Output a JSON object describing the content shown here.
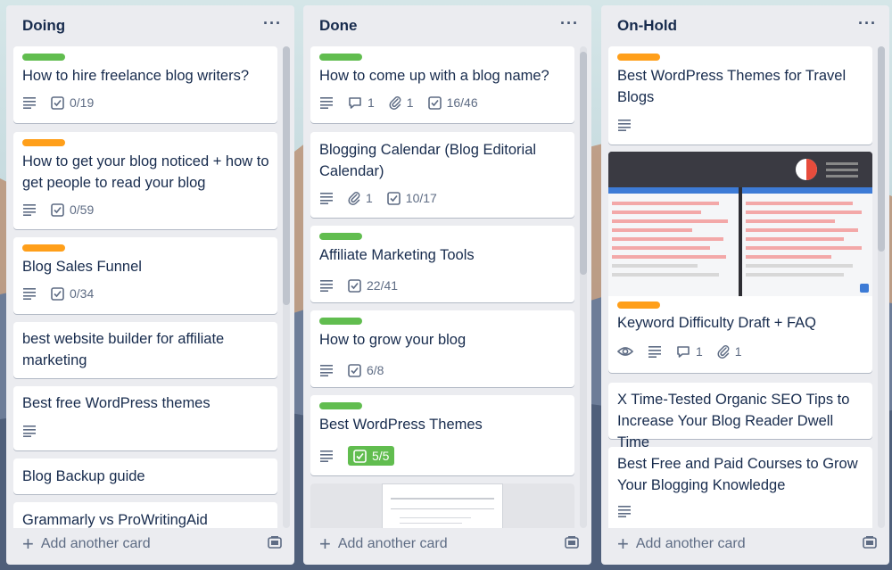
{
  "board": {
    "lists": [
      {
        "title": "Doing",
        "add_card": "Add another card",
        "cards": [
          {
            "label_color": "#61bd4f",
            "title": "How to hire freelance blog writers?",
            "checklist": "0/19"
          },
          {
            "label_color": "#ff9f1a",
            "title": "How to get your blog noticed + how to get people to read your blog",
            "checklist": "0/59"
          },
          {
            "label_color": "#ff9f1a",
            "title": "Blog Sales Funnel",
            "checklist": "0/34"
          },
          {
            "title": "best website builder for affiliate marketing"
          },
          {
            "title": "Best free WordPress themes"
          },
          {
            "title": "Blog Backup guide"
          },
          {
            "title": "Grammarly vs ProWritingAid"
          }
        ]
      },
      {
        "title": "Done",
        "add_card": "Add another card",
        "cards": [
          {
            "label_color": "#61bd4f",
            "title": "How to come up with a blog name?",
            "comments": "1",
            "attachments": "1",
            "checklist": "16/46"
          },
          {
            "title": "Blogging Calendar (Blog Editorial Calendar)",
            "attachments": "1",
            "checklist": "10/17"
          },
          {
            "label_color": "#61bd4f",
            "title": "Affiliate Marketing Tools",
            "checklist": "22/41"
          },
          {
            "label_color": "#61bd4f",
            "title": "How to grow your blog",
            "checklist": "6/8"
          },
          {
            "label_color": "#61bd4f",
            "title": "Best WordPress Themes",
            "checklist": "5/5"
          }
        ]
      },
      {
        "title": "On-Hold",
        "add_card": "Add another card",
        "cards": [
          {
            "label_color": "#ff9f1a",
            "title": "Best WordPress Themes for Travel Blogs"
          },
          {
            "label_color": "#ff9f1a",
            "title": "Keyword Difficulty Draft + FAQ",
            "comments": "1",
            "attachments": "1"
          },
          {
            "title": "X Time-Tested Organic SEO Tips to Increase Your Blog Reader Dwell Time"
          },
          {
            "title": "Best Free and Paid Courses to Grow Your Blogging Knowledge"
          }
        ]
      }
    ]
  },
  "icons": {
    "menu": "more-horizontal-icon",
    "description": "description-lines-icon",
    "checklist": "checkbox-icon",
    "comment": "comment-bubble-icon",
    "attachment": "paperclip-icon",
    "watch": "eye-icon",
    "add": "plus-icon",
    "template": "card-template-icon"
  },
  "colors": {
    "label_green": "#61bd4f",
    "label_orange": "#ff9f1a",
    "list_bg": "#ebecf0",
    "text": "#172b4d",
    "muted": "#5e6c84"
  }
}
